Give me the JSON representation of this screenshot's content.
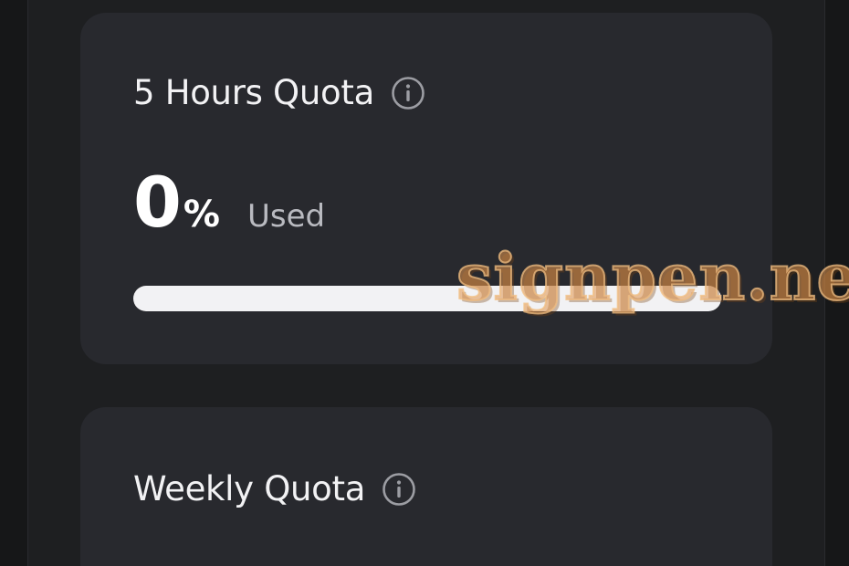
{
  "quota_cards": {
    "five_hours": {
      "title": "5 Hours Quota",
      "usage_value": "0",
      "usage_unit": "%",
      "usage_label": "Used",
      "progress_fraction": 0.0
    },
    "weekly": {
      "title": "Weekly Quota"
    }
  },
  "icons": {
    "info": "info-icon"
  },
  "watermark": {
    "text": "signpen.net"
  },
  "colors": {
    "background": "#161718",
    "panel": "#1e1f21",
    "card": "#28292e",
    "text_primary": "#f2f2f4",
    "text_secondary": "#b9bac0",
    "progress_track": "#f2f2f4",
    "watermark": "#e0964f"
  }
}
